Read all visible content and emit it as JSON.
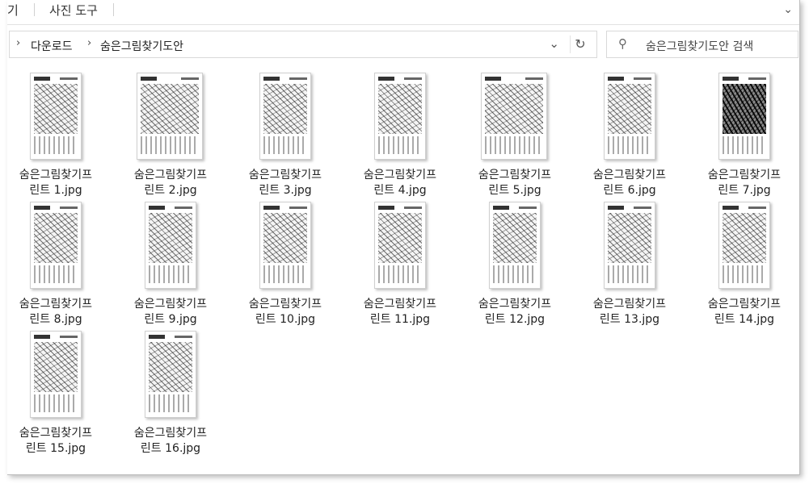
{
  "ribbon": {
    "left_tab": "기",
    "photo_tools": "사진 도구"
  },
  "address": {
    "crumbs": [
      "다운로드",
      "숨은그림찾기도안"
    ]
  },
  "search": {
    "placeholder": "숨은그림찾기도안 검색"
  },
  "files": [
    {
      "line1": "숨은그림찾기프",
      "line2": "린트 1.jpg"
    },
    {
      "line1": "숨은그림찾기프",
      "line2": "린트 2.jpg"
    },
    {
      "line1": "숨은그림찾기프",
      "line2": "린트 3.jpg"
    },
    {
      "line1": "숨은그림찾기프",
      "line2": "린트 4.jpg"
    },
    {
      "line1": "숨은그림찾기프",
      "line2": "린트 5.jpg"
    },
    {
      "line1": "숨은그림찾기프",
      "line2": "린트 6.jpg"
    },
    {
      "line1": "숨은그림찾기프",
      "line2": "린트 7.jpg"
    },
    {
      "line1": "숨은그림찾기프",
      "line2": "린트 8.jpg"
    },
    {
      "line1": "숨은그림찾기프",
      "line2": "린트 9.jpg"
    },
    {
      "line1": "숨은그림찾기프",
      "line2": "린트 10.jpg"
    },
    {
      "line1": "숨은그림찾기프",
      "line2": "린트 11.jpg"
    },
    {
      "line1": "숨은그림찾기프",
      "line2": "린트 12.jpg"
    },
    {
      "line1": "숨은그림찾기프",
      "line2": "린트 13.jpg"
    },
    {
      "line1": "숨은그림찾기프",
      "line2": "린트 14.jpg"
    },
    {
      "line1": "숨은그림찾기프",
      "line2": "린트 15.jpg"
    },
    {
      "line1": "숨은그림찾기프",
      "line2": "린트 16.jpg"
    }
  ]
}
